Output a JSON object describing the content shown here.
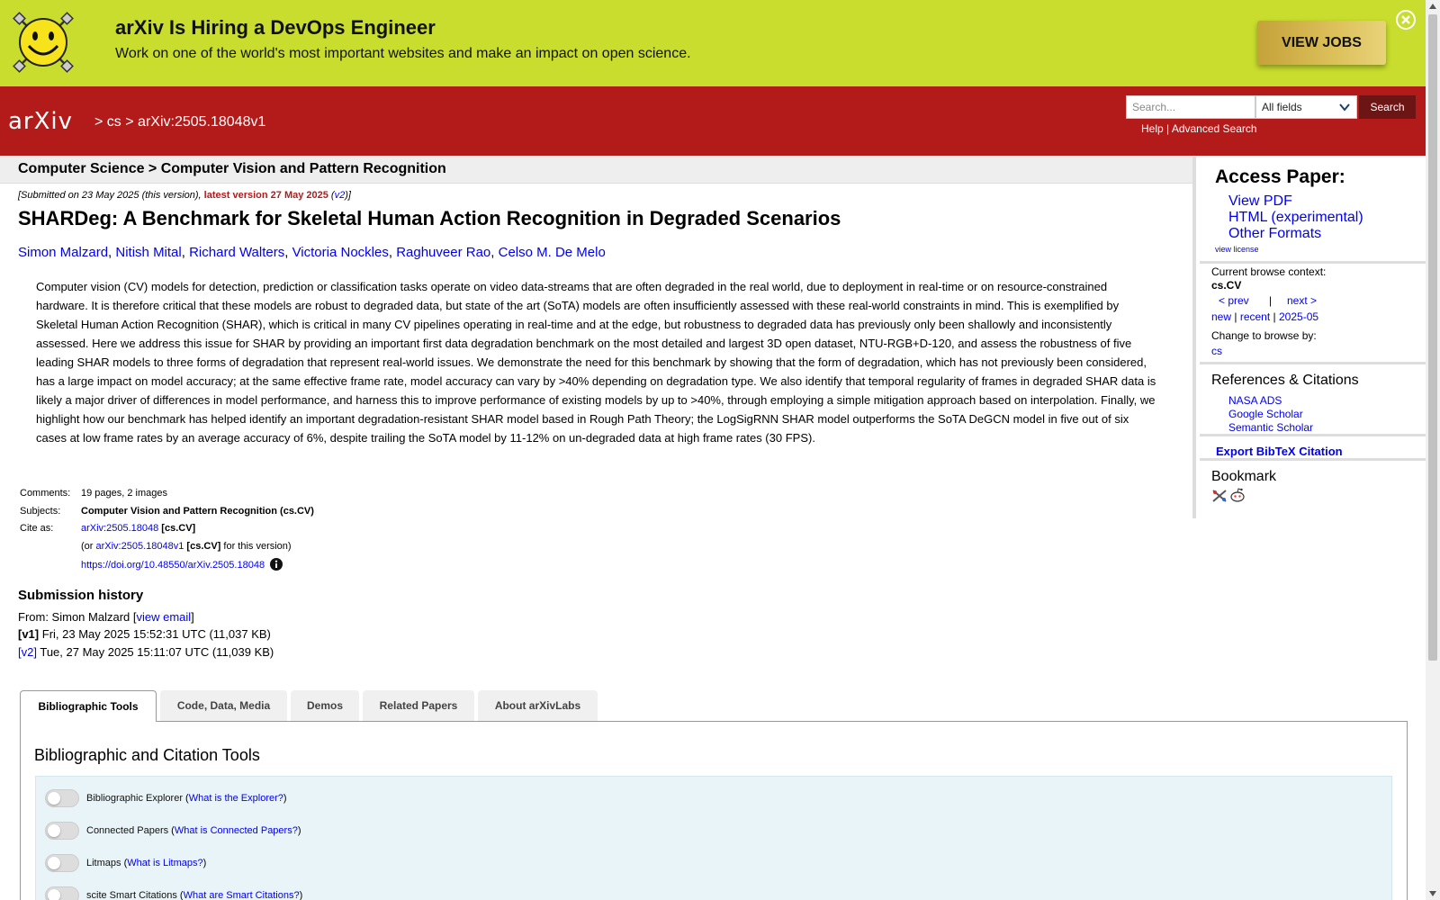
{
  "banner": {
    "title": "arXiv Is Hiring a DevOps Engineer",
    "subtitle": "Work on one of the world's most important websites and make an impact on open science.",
    "cta": "VIEW JOBS",
    "close_icon": "close-circle-icon",
    "logo_icon": "smiley-icon"
  },
  "header": {
    "logo_text": "arXiv",
    "breadcrumb_sep": ">",
    "crumb_cs": "cs",
    "crumb_id": "arXiv:2505.18048v1",
    "search_placeholder": "Search...",
    "search_field": "All fields",
    "search_button": "Search",
    "help": "Help",
    "help_sep": "|",
    "advanced": "Advanced Search",
    "color": "#b31b1b"
  },
  "subject_bar": "Computer Science > Computer Vision and Pattern Recognition",
  "dateline": {
    "submitted": "[Submitted on 23 May 2025 (this version), ",
    "latest": "latest version 27 May 2025",
    "open": " (",
    "v2": "v2",
    "close": ")]"
  },
  "title": "SHARDeg: A Benchmark for Skeletal Human Action Recognition in Degraded Scenarios",
  "authors": [
    "Simon Malzard",
    "Nitish Mital",
    "Richard Walters",
    "Victoria Nockles",
    "Raghuveer Rao",
    "Celso M. De Melo"
  ],
  "abstract": "Computer vision (CV) models for detection, prediction or classification tasks operate on video data-streams that are often degraded in the real world, due to deployment in real-time or on resource-constrained hardware. It is therefore critical that these models are robust to degraded data, but state of the art (SoTA) models are often insufficiently assessed with these real-world constraints in mind. This is exemplified by Skeletal Human Action Recognition (SHAR), which is critical in many CV pipelines operating in real-time and at the edge, but robustness to degraded data has previously only been shallowly and inconsistently assessed. Here we address this issue for SHAR by providing an important first data degradation benchmark on the most detailed and largest 3D open dataset, NTU-RGB+D-120, and assess the robustness of five leading SHAR models to three forms of degradation that represent real-world issues. We demonstrate the need for this benchmark by showing that the form of degradation, which has not previously been considered, has a large impact on model accuracy; at the same effective frame rate, model accuracy can vary by >40% depending on degradation type. We also identify that temporal regularity of frames in degraded SHAR data is likely a major driver of differences in model performance, and harness this to improve performance of existing models by up to >40%, through employing a simple mitigation approach based on interpolation. Finally, we highlight how our benchmark has helped identify an important degradation-resistant SHAR model based in Rough Path Theory; the LogSigRNN SHAR model outperforms the SoTA DeGCN model in five out of six cases at low frame rates by an average accuracy of 6%, despite trailing the SoTA model by 11-12% on un-degraded data at high frame rates (30 FPS).",
  "meta": {
    "comments_label": "Comments:",
    "comments": "19 pages, 2 images",
    "subjects_label": "Subjects:",
    "subjects": "Computer Vision and Pattern Recognition (cs.CV)",
    "cite_label": "Cite as:",
    "cite_id": "arXiv:2505.18048",
    "cite_cat": "[cs.CV]",
    "or_open": "(or ",
    "cite_v1": "arXiv:2505.18048v1",
    "cite_v1_cat": "[cs.CV]",
    "for_version": "for this version)",
    "doi": "https://doi.org/10.48550/arXiv.2505.18048",
    "info_icon": "info-icon"
  },
  "history": {
    "title": "Submission history",
    "from_prefix": "From: Simon Malzard [",
    "view_email": "view email",
    "from_suffix": "]",
    "v1_label": "[v1]",
    "v1_text": "Fri, 23 May 2025 15:52:31 UTC (11,037 KB)",
    "v2_label": "[v2]",
    "v2_text": "Tue, 27 May 2025 15:11:07 UTC (11,039 KB)"
  },
  "tabs": [
    "Bibliographic Tools",
    "Code, Data, Media",
    "Demos",
    "Related Papers",
    "About arXivLabs"
  ],
  "panel": {
    "title": "Bibliographic and Citation Tools",
    "tools": [
      {
        "name": "Bibliographic Explorer",
        "link": "What is the Explorer?"
      },
      {
        "name": "Connected Papers",
        "link": "What is Connected Papers?"
      },
      {
        "name": "Litmaps",
        "link": "What is Litmaps?"
      },
      {
        "name": "scite Smart Citations",
        "link": "What are Smart Citations?"
      }
    ]
  },
  "sidebar": {
    "access_title": "Access Paper:",
    "view_pdf": "View PDF",
    "html": "HTML (experimental)",
    "other": "Other Formats",
    "license": "view license",
    "context_label": "Current browse context:",
    "context": "cs.CV",
    "prev": "< prev",
    "nav_sep": "|",
    "next": "next >",
    "new": "new",
    "recent": "recent",
    "month": "2025-05",
    "change_label": "Change to browse by:",
    "change_cs": "cs",
    "refs_title": "References & Citations",
    "nasa": "NASA ADS",
    "google": "Google Scholar",
    "semantic": "Semantic Scholar",
    "export": "Export BibTeX Citation",
    "bookmark": "Bookmark",
    "bookmark_icons": [
      "bibsonomy-icon",
      "reddit-icon"
    ]
  }
}
